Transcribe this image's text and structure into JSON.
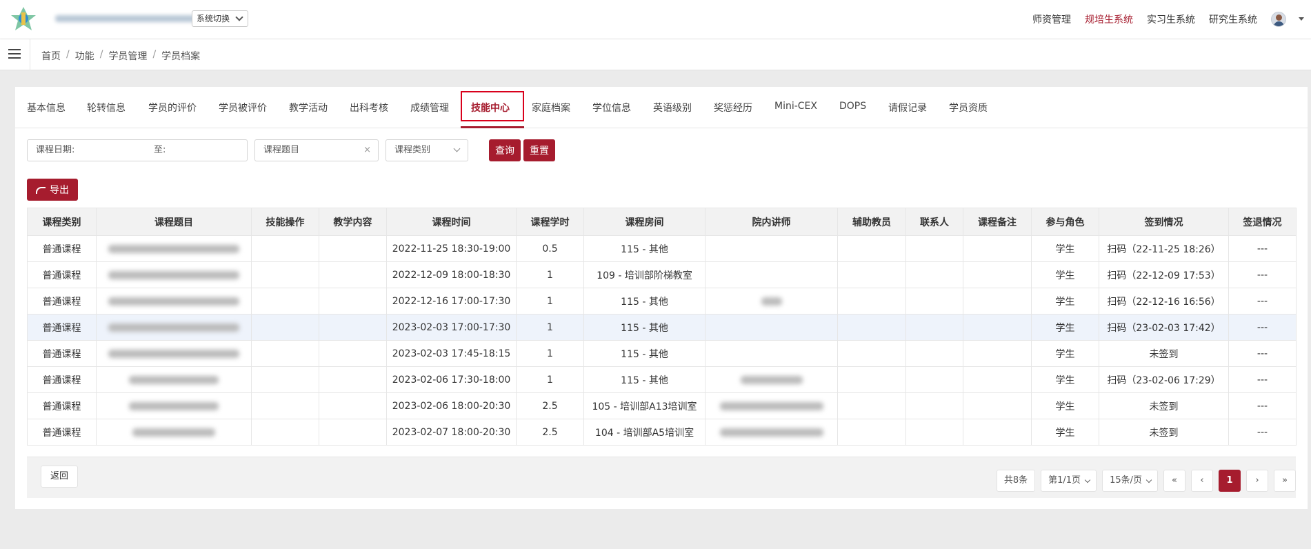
{
  "header": {
    "system_switch": "系统切换",
    "nav": [
      "师资管理",
      "规培生系统",
      "实习生系统",
      "研究生系统"
    ],
    "active_nav": 1
  },
  "breadcrumb": [
    "首页",
    "功能",
    "学员管理",
    "学员档案"
  ],
  "tabs": [
    "基本信息",
    "轮转信息",
    "学员的评价",
    "学员被评价",
    "教学活动",
    "出科考核",
    "成绩管理",
    "技能中心",
    "家庭档案",
    "学位信息",
    "英语级别",
    "奖惩经历",
    "Mini-CEX",
    "DOPS",
    "请假记录",
    "学员资质"
  ],
  "active_tab": 7,
  "filters": {
    "date_label": "课程日期:",
    "date_to": "至:",
    "topic_placeholder": "课程题目",
    "clear_icon": "×",
    "category_placeholder": "课程类别",
    "query_button": "查询",
    "reset_button": "重置"
  },
  "export_button": "导出",
  "table": {
    "columns": [
      "课程类别",
      "课程题目",
      "技能操作",
      "教学内容",
      "课程时间",
      "课程学时",
      "课程房间",
      "院内讲师",
      "辅助教员",
      "联系人",
      "课程备注",
      "参与角色",
      "签到情况",
      "签退情况"
    ],
    "rows": [
      {
        "category": "普通课程",
        "time": "2022-11-25 18:30-19:00",
        "hours": "0.5",
        "room": "115 - 其他",
        "role": "学生",
        "signin": "扫码（22-11-25 18:26）",
        "signout": "---"
      },
      {
        "category": "普通课程",
        "time": "2022-12-09 18:00-18:30",
        "hours": "1",
        "room": "109 - 培训部阶梯教室",
        "role": "学生",
        "signin": "扫码（22-12-09 17:53）",
        "signout": "---"
      },
      {
        "category": "普通课程",
        "time": "2022-12-16 17:00-17:30",
        "hours": "1",
        "room": "115 - 其他",
        "role": "学生",
        "signin": "扫码（22-12-16 16:56）",
        "signout": "---"
      },
      {
        "category": "普通课程",
        "time": "2023-02-03 17:00-17:30",
        "hours": "1",
        "room": "115 - 其他",
        "role": "学生",
        "signin": "扫码（23-02-03 17:42）",
        "signout": "---"
      },
      {
        "category": "普通课程",
        "time": "2023-02-03 17:45-18:15",
        "hours": "1",
        "room": "115 - 其他",
        "role": "学生",
        "signin": "未签到",
        "signout": "---"
      },
      {
        "category": "普通课程",
        "time": "2023-02-06 17:30-18:00",
        "hours": "1",
        "room": "115 - 其他",
        "role": "学生",
        "signin": "扫码（23-02-06 17:29）",
        "signout": "---"
      },
      {
        "category": "普通课程",
        "time": "2023-02-06 18:00-20:30",
        "hours": "2.5",
        "room": "105 - 培训部A13培训室",
        "role": "学生",
        "signin": "未签到",
        "signout": "---"
      },
      {
        "category": "普通课程",
        "time": "2023-02-07 18:00-20:30",
        "hours": "2.5",
        "room": "104 - 培训部A5培训室",
        "role": "学生",
        "signin": "未签到",
        "signout": "---"
      }
    ]
  },
  "footer": {
    "back_button": "返回",
    "total": "共8条",
    "page_info": "第1/1页",
    "page_size": "15条/页",
    "first": "«",
    "prev": "‹",
    "current": "1",
    "next": "›",
    "last": "»"
  },
  "colors": {
    "accent": "#a61c2e",
    "highlight_box": "#d9001b",
    "row_highlight": "#eef3fb"
  }
}
